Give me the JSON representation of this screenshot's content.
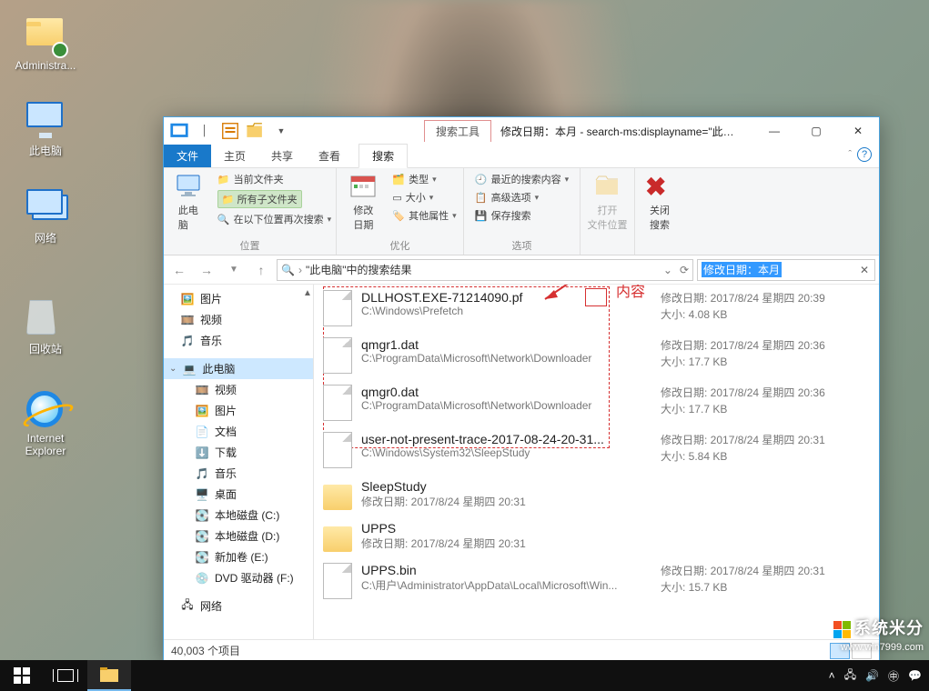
{
  "desktop": {
    "icons": [
      {
        "label": "Administra...",
        "type": "folder",
        "name": "administrator-folder"
      },
      {
        "label": "此电脑",
        "type": "pc",
        "name": "this-pc"
      },
      {
        "label": "网络",
        "type": "net",
        "name": "network"
      },
      {
        "label": "回收站",
        "type": "bin",
        "name": "recycle-bin"
      },
      {
        "label": "Internet Explorer",
        "type": "ie",
        "name": "internet-explorer"
      }
    ]
  },
  "window": {
    "tool_tab": "搜索工具",
    "title": "修改日期：本月 - search-ms:displayname=\"此电脑\"中的搜...",
    "tabs": {
      "file": "文件",
      "home": "主页",
      "share": "共享",
      "view": "查看",
      "search": "搜索"
    },
    "ribbon": {
      "group_location": "位置",
      "this_pc": "此电\n脑",
      "current_folder": "当前文件夹",
      "all_subfolders": "所有子文件夹",
      "search_again_in": "在以下位置再次搜索",
      "group_refine": "优化",
      "modify_date": "修改\n日期",
      "type": "类型",
      "size": "大小",
      "other_props": "其他属性",
      "group_options": "选项",
      "recent_searches": "最近的搜索内容",
      "advanced_options": "高级选项",
      "save_search": "保存搜索",
      "open_location": "打开\n文件位置",
      "close_search": "关闭\n搜索"
    },
    "breadcrumb": "\"此电脑\"中的搜索结果",
    "search_value": "修改日期：本月",
    "tree": {
      "pictures": "图片",
      "videos": "视频",
      "music": "音乐",
      "this_pc": "此电脑",
      "videos2": "视频",
      "pictures2": "图片",
      "documents": "文档",
      "downloads": "下载",
      "music2": "音乐",
      "desktop": "桌面",
      "c": "本地磁盘 (C:)",
      "d": "本地磁盘 (D:)",
      "e": "新加卷 (E:)",
      "dvd": "DVD 驱动器 (F:)",
      "network": "网络"
    },
    "annotation": "内容",
    "files": [
      {
        "name": "DLLHOST.EXE-71214090.pf",
        "path": "C:\\Windows\\Prefetch",
        "date": "修改日期: 2017/8/24 星期四 20:39",
        "size": "大小: 4.08 KB",
        "icon": "file"
      },
      {
        "name": "qmgr1.dat",
        "path": "C:\\ProgramData\\Microsoft\\Network\\Downloader",
        "date": "修改日期: 2017/8/24 星期四 20:36",
        "size": "大小: 17.7 KB",
        "icon": "file"
      },
      {
        "name": "qmgr0.dat",
        "path": "C:\\ProgramData\\Microsoft\\Network\\Downloader",
        "date": "修改日期: 2017/8/24 星期四 20:36",
        "size": "大小: 17.7 KB",
        "icon": "file"
      },
      {
        "name": "user-not-present-trace-2017-08-24-20-31...",
        "path": "C:\\Windows\\System32\\SleepStudy",
        "date": "修改日期: 2017/8/24 星期四 20:31",
        "size": "大小: 5.84 KB",
        "icon": "file"
      },
      {
        "name": "SleepStudy",
        "path": "修改日期: 2017/8/24 星期四 20:31",
        "date": "",
        "size": "",
        "icon": "folder"
      },
      {
        "name": "UPPS",
        "path": "修改日期: 2017/8/24 星期四 20:31",
        "date": "",
        "size": "",
        "icon": "folder"
      },
      {
        "name": "UPPS.bin",
        "path": "C:\\用户\\Administrator\\AppData\\Local\\Microsoft\\Win...",
        "date": "修改日期: 2017/8/24 星期四 20:31",
        "size": "大小: 15.7 KB",
        "icon": "file"
      }
    ],
    "status": "40,003 个项目"
  },
  "watermark": {
    "brand": "系统米分",
    "url": "www.win7999.com"
  },
  "meta_labels": {
    "mod": "修改日期:",
    "sz": "大小:"
  }
}
